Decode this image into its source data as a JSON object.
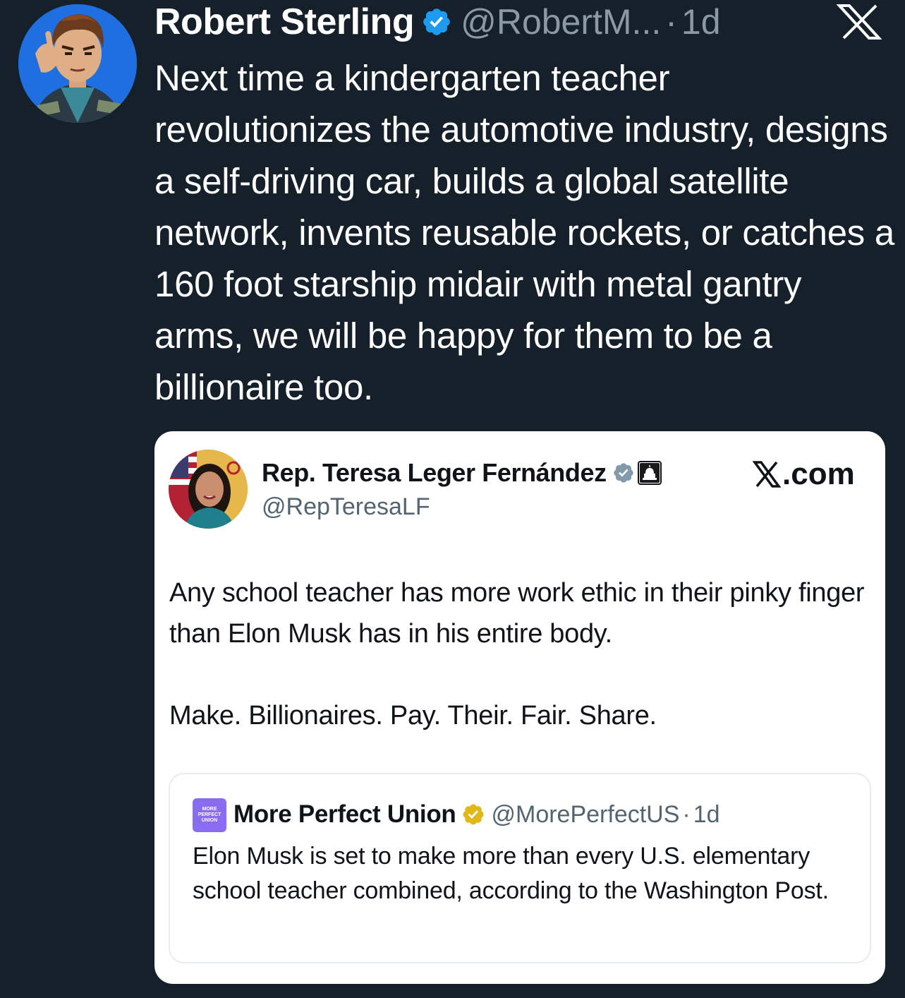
{
  "tweet": {
    "author_name": "Robert Sterling",
    "handle": "@RobertM...",
    "separator": "·",
    "time": "1d",
    "text": "Next time a kindergarten teacher revolutionizes the automotive industry, designs a self-driving car, builds a global satellite network, invents reusable rockets, or catches a 160 foot starship midair with metal gantry arms, we will be happy for them to be a billionaire too.",
    "verified_badge_color": "#1d9bf0",
    "avatar_bg_color": "#1f6fe0",
    "platform_icon": "x-logo-icon"
  },
  "quoted_tweet": {
    "author_name": "Rep. Teresa Leger Fernández",
    "handle": "@RepTeresaLF",
    "source_label": ".com",
    "text_1": "Any school teacher has more work ethic in their pinky finger than Elon Musk has in his entire body.",
    "text_2": "Make. Billionaires. Pay. Their. Fair. Share.",
    "verified_badge_color": "#829aab",
    "government_icon": "capitol-building-icon"
  },
  "nested_quote": {
    "logo_text": "MORE PERFECT UNION",
    "author_name": "More Perfect Union",
    "handle": "@MorePerfectUS",
    "separator": "·",
    "time": "1d",
    "text": "Elon Musk is set to make more than every U.S. elementary school teacher combined, according to the Washington Post.",
    "verified_badge_color": "#e2b719",
    "logo_color": "#8a6cf0"
  }
}
